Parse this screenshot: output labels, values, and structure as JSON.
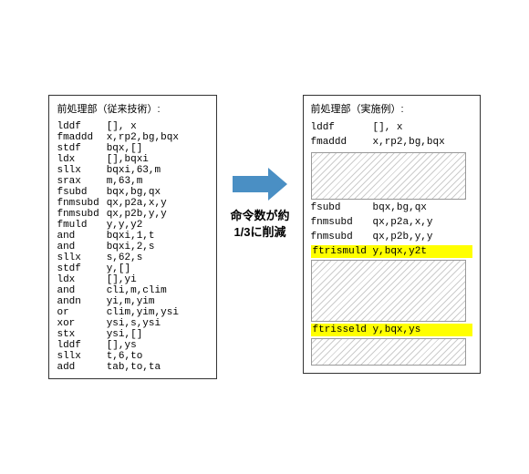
{
  "left_panel": {
    "title": "前処理部（従来技術）:",
    "instructions": [
      {
        "op": "lddf",
        "args": "[], x"
      },
      {
        "op": "fmaddd",
        "args": "x,rp2,bg,bqx"
      },
      {
        "op": "stdf",
        "args": "bqx,[]"
      },
      {
        "op": "ldx",
        "args": "[],bqxi"
      },
      {
        "op": "sllx",
        "args": "bqxi,63,m"
      },
      {
        "op": "srax",
        "args": "m,63,m"
      },
      {
        "op": "fsubd",
        "args": "bqx,bg,qx"
      },
      {
        "op": "fnmsubd",
        "args": "qx,p2a,x,y"
      },
      {
        "op": "fnmsubd",
        "args": "qx,p2b,y,y"
      },
      {
        "op": "fmuld",
        "args": "y,y,y2"
      },
      {
        "op": "and",
        "args": "bqxi,1,t"
      },
      {
        "op": "and",
        "args": "bqxi,2,s"
      },
      {
        "op": "sllx",
        "args": "s,62,s"
      },
      {
        "op": "stdf",
        "args": "y,[]"
      },
      {
        "op": "ldx",
        "args": "[],yi"
      },
      {
        "op": "and",
        "args": "cli,m,clim"
      },
      {
        "op": "andn",
        "args": "yi,m,yim"
      },
      {
        "op": "or",
        "args": "clim,yim,ysi"
      },
      {
        "op": "xor",
        "args": "ysi,s,ysi"
      },
      {
        "op": "stx",
        "args": "ysi,[]"
      },
      {
        "op": "lddf",
        "args": "[],ys"
      },
      {
        "op": "sllx",
        "args": "t,6,to"
      },
      {
        "op": "add",
        "args": "tab,to,ta"
      }
    ]
  },
  "arrow": {
    "label": "命令数が約\n1/3に削減"
  },
  "right_panel": {
    "title": "前処理部（実施例）:",
    "top_instructions": [
      {
        "op": "lddf",
        "args": "[], x"
      },
      {
        "op": "fmaddd",
        "args": "x,rp2,bg,bqx"
      }
    ],
    "mid_instructions": [
      {
        "op": "fsubd",
        "args": "bqx,bg,qx"
      },
      {
        "op": "fnmsubd",
        "args": "qx,p2a,x,y"
      },
      {
        "op": "fnmsubd",
        "args": "qx,p2b,y,y"
      }
    ],
    "highlighted1": "ftrismuld y,bqx,y2t",
    "highlighted2": "ftrisseld y,bqx,ys"
  }
}
